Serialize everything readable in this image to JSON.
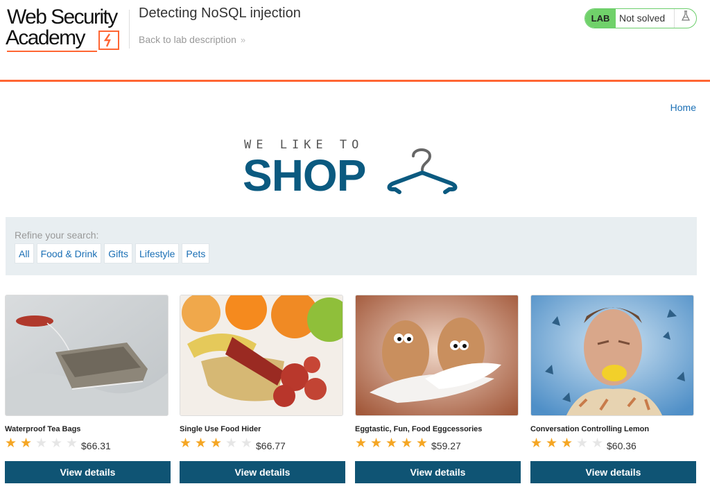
{
  "header": {
    "logo_line1": "Web Security",
    "logo_line2": "Academy",
    "lab_title": "Detecting NoSQL injection",
    "back_link": "Back to lab description",
    "back_chevron": "»",
    "badge_label": "LAB",
    "badge_status": "Not solved",
    "badge_icon": "flask-icon",
    "accent_color": "#ff6633",
    "badge_color": "#70d16a"
  },
  "nav": {
    "home": "Home"
  },
  "shop_logo": {
    "tagline": "WE LIKE TO",
    "word": "SHOP",
    "icon": "hanger-icon",
    "color": "#0b5a80"
  },
  "filter": {
    "label": "Refine your search:",
    "categories": [
      "All",
      "Food & Drink",
      "Gifts",
      "Lifestyle",
      "Pets"
    ]
  },
  "products": [
    {
      "name": "Waterproof Tea Bags",
      "rating": 2,
      "max_rating": 5,
      "price": "$66.31",
      "button": "View details"
    },
    {
      "name": "Single Use Food Hider",
      "rating": 3,
      "max_rating": 5,
      "price": "$66.77",
      "button": "View details"
    },
    {
      "name": "Eggtastic, Fun, Food Eggcessories",
      "rating": 5,
      "max_rating": 5,
      "price": "$59.27",
      "button": "View details"
    },
    {
      "name": "Conversation Controlling Lemon",
      "rating": 3,
      "max_rating": 5,
      "price": "$60.36",
      "button": "View details"
    }
  ]
}
